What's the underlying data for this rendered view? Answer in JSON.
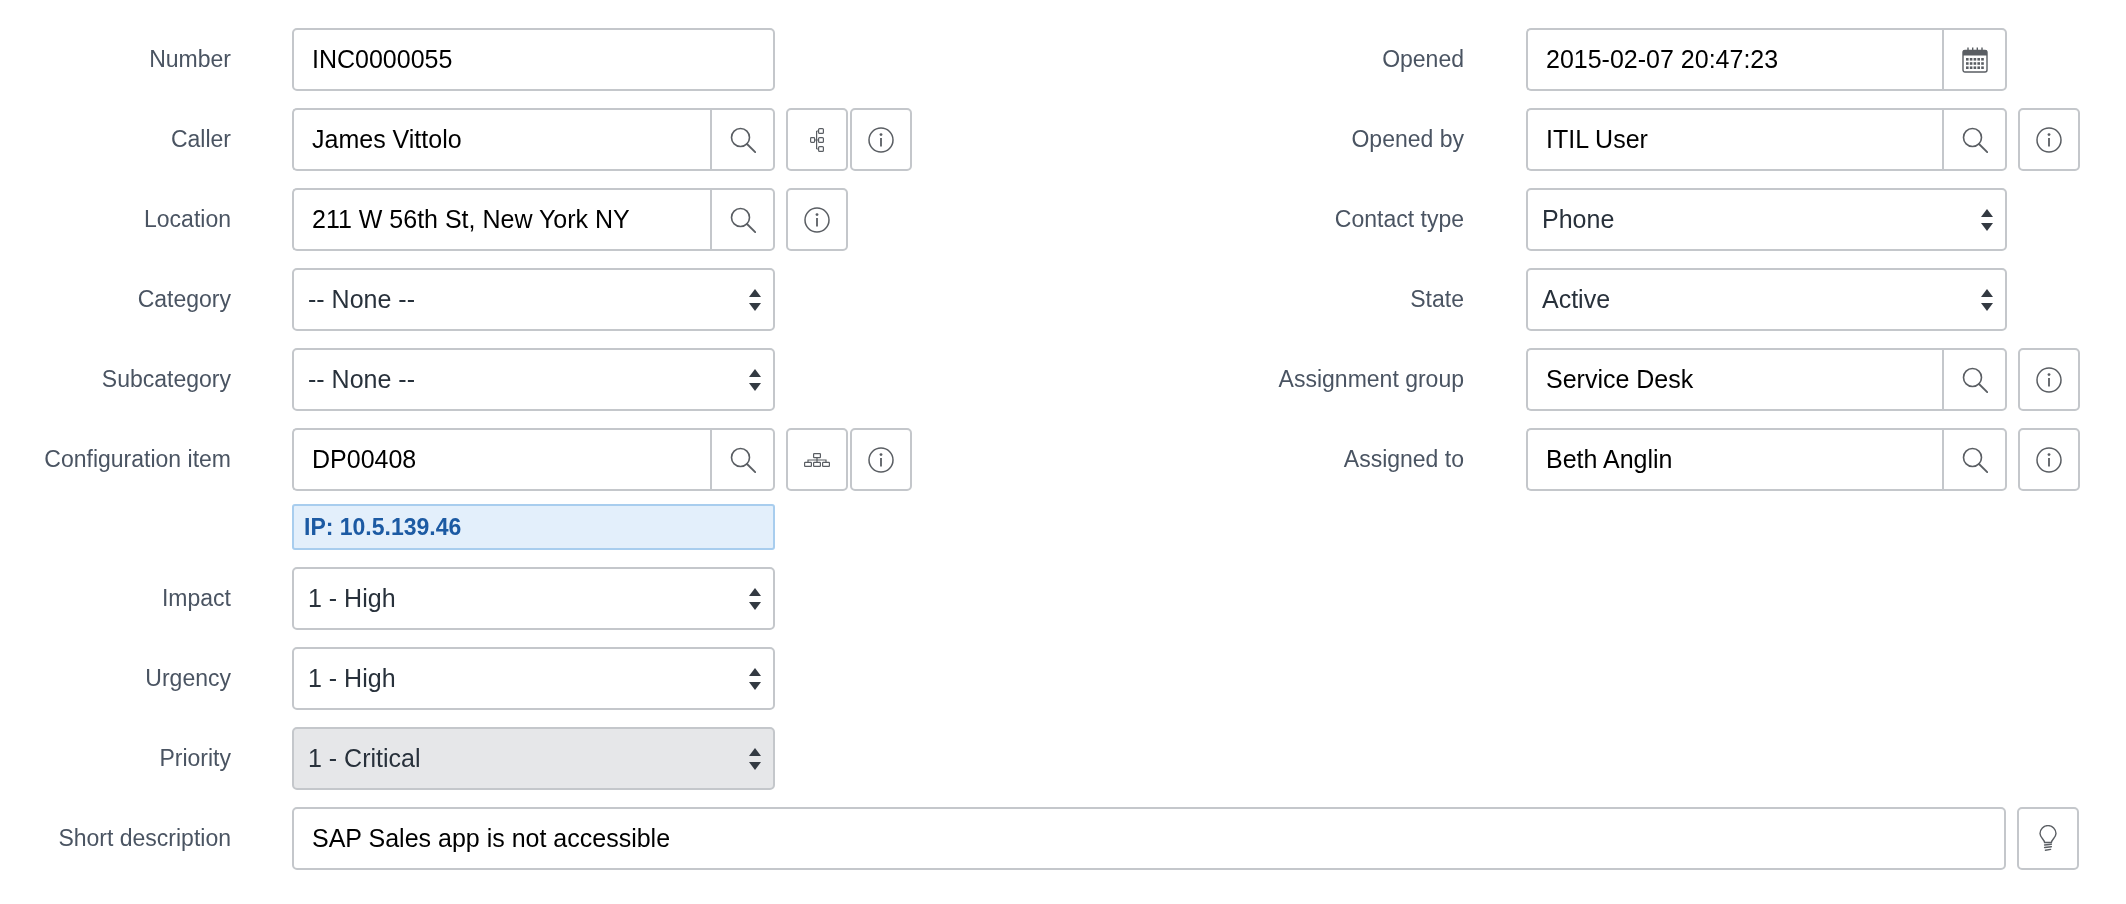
{
  "left_fields": [
    {
      "label": "Number",
      "kind": "text",
      "value": "INC0000055",
      "readonly": false
    },
    {
      "label": "Caller",
      "kind": "reference",
      "value": "James Vittolo",
      "readonly": false,
      "buttons": [
        {
          "kind": "tree"
        },
        {
          "kind": "info"
        }
      ]
    },
    {
      "label": "Location",
      "kind": "reference",
      "value": "211 W 56th St, New York NY",
      "readonly": false,
      "buttons": [
        {
          "kind": "info"
        }
      ]
    },
    {
      "label": "Category",
      "kind": "select",
      "value": "-- None --",
      "readonly": false
    },
    {
      "label": "Subcategory",
      "kind": "select",
      "value": "-- None --",
      "readonly": false
    },
    {
      "label": "Configuration item",
      "kind": "reference",
      "value": "DP00408",
      "readonly": false,
      "buttons": [
        {
          "kind": "hierarchy"
        },
        {
          "kind": "info"
        }
      ],
      "note": "IP: 10.5.139.46"
    },
    {
      "label": "Impact",
      "kind": "select",
      "value": "1 - High",
      "readonly": false
    },
    {
      "label": "Urgency",
      "kind": "select",
      "value": "1 - High",
      "readonly": false
    },
    {
      "label": "Priority",
      "kind": "select",
      "value": "1 - Critical",
      "readonly": true
    }
  ],
  "right_fields": [
    {
      "label": "Opened",
      "kind": "date",
      "value": "2015-02-07 20:47:23",
      "readonly": false
    },
    {
      "label": "Opened by",
      "kind": "reference",
      "value": "ITIL User",
      "readonly": false,
      "buttons": [
        {
          "kind": "info"
        }
      ]
    },
    {
      "label": "Contact type",
      "kind": "select",
      "value": "Phone",
      "readonly": false
    },
    {
      "label": "State",
      "kind": "select",
      "value": "Active",
      "readonly": false
    },
    {
      "label": "Assignment group",
      "kind": "reference",
      "value": "Service Desk",
      "readonly": false,
      "buttons": [
        {
          "kind": "info"
        }
      ]
    },
    {
      "label": "Assigned to",
      "kind": "reference",
      "value": "Beth Anglin",
      "readonly": false,
      "buttons": [
        {
          "kind": "info"
        }
      ]
    }
  ],
  "short_description": {
    "label": "Short description",
    "kind": "text",
    "value": "SAP Sales app is not accessible",
    "readonly": false,
    "buttons": [
      {
        "kind": "lightbulb"
      }
    ]
  }
}
